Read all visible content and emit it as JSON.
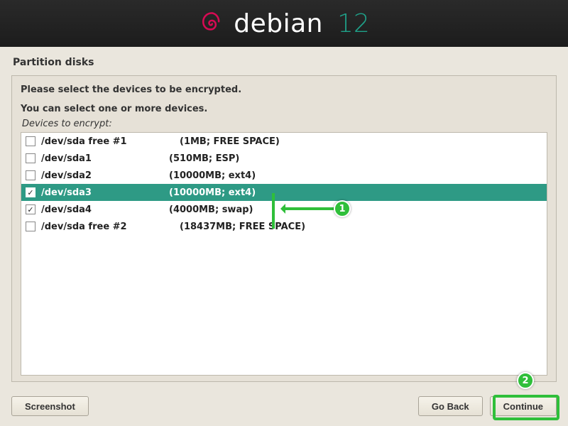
{
  "brand": {
    "name": "debian",
    "version": "12"
  },
  "page_title": "Partition disks",
  "instructions": {
    "line1": "Please select the devices to be encrypted.",
    "line2": "You can select one or more devices.",
    "line3": "Devices to encrypt:"
  },
  "devices": [
    {
      "name": "/dev/sda free #1",
      "detail": "(1MB; FREE SPACE)",
      "checked": false,
      "selected": false,
      "wide": true
    },
    {
      "name": "/dev/sda1",
      "detail": "(510MB; ESP)",
      "checked": false,
      "selected": false,
      "wide": false
    },
    {
      "name": "/dev/sda2",
      "detail": "(10000MB; ext4)",
      "checked": false,
      "selected": false,
      "wide": false
    },
    {
      "name": "/dev/sda3",
      "detail": "(10000MB; ext4)",
      "checked": true,
      "selected": true,
      "wide": false
    },
    {
      "name": "/dev/sda4",
      "detail": "(4000MB; swap)",
      "checked": true,
      "selected": false,
      "wide": false
    },
    {
      "name": "/dev/sda free #2",
      "detail": "(18437MB; FREE SPACE)",
      "checked": false,
      "selected": false,
      "wide": true
    }
  ],
  "buttons": {
    "screenshot": "Screenshot",
    "go_back": "Go Back",
    "continue": "Continue"
  },
  "annotations": {
    "badge1": "1",
    "badge2": "2"
  }
}
